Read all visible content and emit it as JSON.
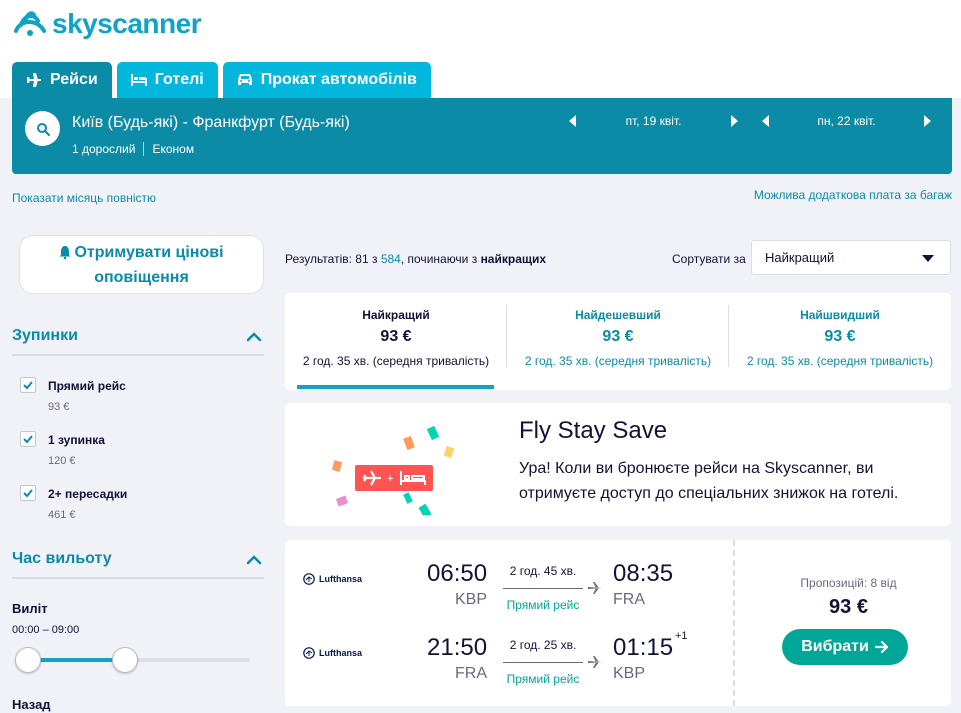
{
  "brand": {
    "name": "skyscanner",
    "color": "#0fa3c6"
  },
  "tabs": [
    {
      "label": "Рейси",
      "icon": "plane-icon",
      "active": true
    },
    {
      "label": "Готелі",
      "icon": "bed-icon",
      "active": false
    },
    {
      "label": "Прокат автомобілів",
      "icon": "car-icon",
      "active": false
    }
  ],
  "search": {
    "route": "Київ (Будь-які) - Франкфурт (Будь-які)",
    "passengers": "1 дорослий",
    "cabin": "Економ",
    "depart_date": "пт, 19 квіт.",
    "return_date": "пн, 22 квіт."
  },
  "links": {
    "full_month": "Показати місяць повністю",
    "baggage": "Можлива додаткова плата за багаж"
  },
  "price_alert": {
    "line1": "Отримувати цінові",
    "line2": "оповіщення"
  },
  "filters": {
    "stops_title": "Зупинки",
    "stops": [
      {
        "label": "Прямий рейс",
        "price": "93 €",
        "checked": true
      },
      {
        "label": "1 зупинка",
        "price": "120 €",
        "checked": true
      },
      {
        "label": "2+ пересадки",
        "price": "461 €",
        "checked": true
      }
    ],
    "time_title": "Час вильоту",
    "outbound_label": "Виліт",
    "outbound_range": "00:00 – 09:00",
    "return_label": "Назад"
  },
  "results": {
    "prefix": "Результатів: ",
    "shown": "81",
    "of": " з ",
    "total": "584",
    "suffix": ", починаючи з ",
    "sort_word": "найкращих",
    "sort_label": "Сортувати за",
    "sort_value": "Найкращий"
  },
  "sort_tabs": [
    {
      "title": "Найкращий",
      "price": "93 €",
      "duration": "2 год. 35 хв. (середня тривалість)"
    },
    {
      "title": "Найдешевший",
      "price": "93 €",
      "duration": "2 год. 35 хв. (середня тривалість)"
    },
    {
      "title": "Найшвидший",
      "price": "93 €",
      "duration": "2 год. 35 хв. (середня тривалість)"
    }
  ],
  "promo": {
    "title": "Fly Stay Save",
    "text": "Ура! Коли ви бронюєте рейси на Skyscanner, ви отримуєте доступ до спеціальних знижок на готелі."
  },
  "itinerary": {
    "airline": "Lufthansa",
    "legs": [
      {
        "dep_time": "06:50",
        "dep_code": "KBP",
        "duration": "2 год. 45 хв.",
        "type": "Прямий рейс",
        "arr_time": "08:35",
        "arr_code": "FRA",
        "day_offset": ""
      },
      {
        "dep_time": "21:50",
        "dep_code": "FRA",
        "duration": "2 год. 25 хв.",
        "type": "Прямий рейс",
        "arr_time": "01:15",
        "arr_code": "KBP",
        "day_offset": "+1"
      }
    ],
    "offers": "Пропозицій: 8 від",
    "price": "93 €",
    "select_label": "Вибрати"
  }
}
